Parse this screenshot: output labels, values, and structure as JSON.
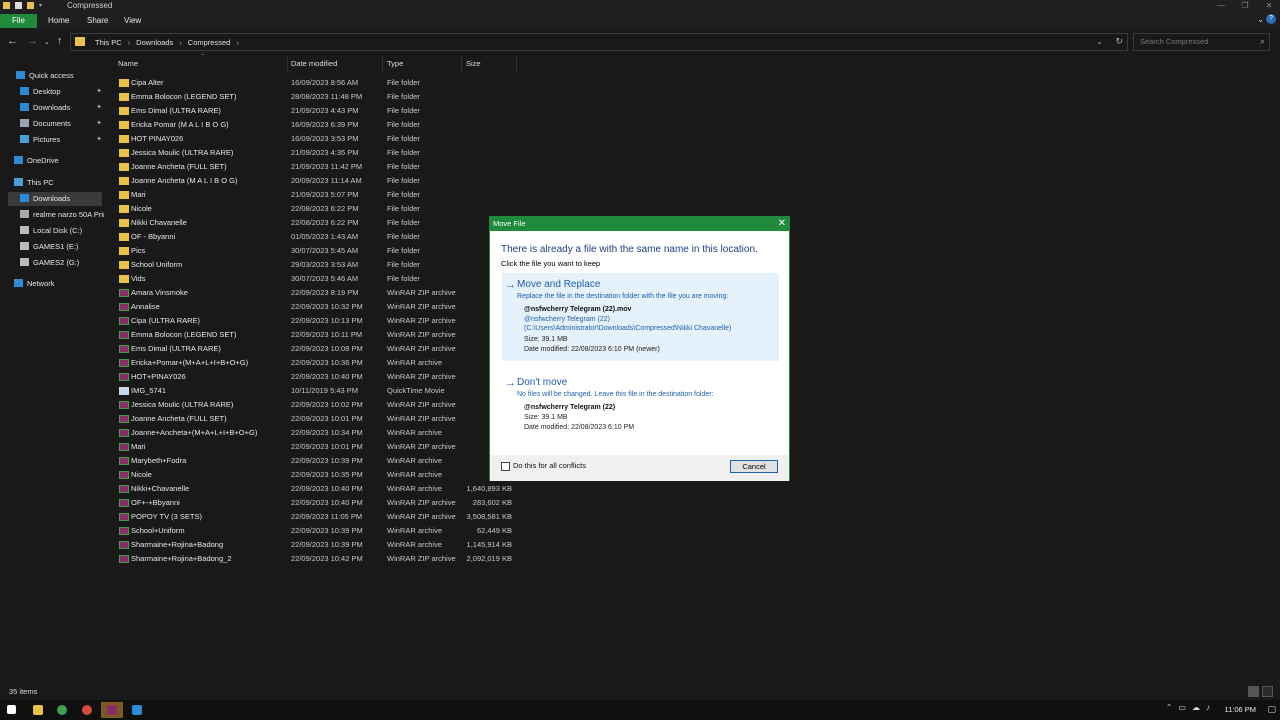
{
  "window": {
    "title": "Compressed",
    "controls": [
      "—",
      "❐",
      "✕"
    ]
  },
  "ribbon": {
    "tabs": [
      "File",
      "Home",
      "Share",
      "View"
    ]
  },
  "address": {
    "crumbs": [
      "This PC",
      "Downloads",
      "Compressed"
    ],
    "search_placeholder": "Search Compressed"
  },
  "nav": {
    "items": [
      {
        "label": "Quick access",
        "icon": "star-icon"
      },
      {
        "label": "Desktop",
        "icon": "desktop-icon",
        "pinned": true
      },
      {
        "label": "Downloads",
        "icon": "download-icon",
        "pinned": true
      },
      {
        "label": "Documents",
        "icon": "document-icon",
        "pinned": true
      },
      {
        "label": "Pictures",
        "icon": "picture-icon",
        "pinned": true
      },
      {
        "label": "OneDrive",
        "icon": "cloud-icon"
      },
      {
        "label": "This PC",
        "icon": "pc-icon"
      },
      {
        "label": "Downloads",
        "icon": "download-icon"
      },
      {
        "label": "realme narzo 50A Prime",
        "icon": "phone-icon"
      },
      {
        "label": "Local Disk (C:)",
        "icon": "drive-icon"
      },
      {
        "label": "GAMES1 (E:)",
        "icon": "drive-icon"
      },
      {
        "label": "GAMES2 (G:)",
        "icon": "drive-icon"
      },
      {
        "label": "Network",
        "icon": "network-icon"
      }
    ]
  },
  "columns": [
    "Name",
    "Date modified",
    "Type",
    "Size"
  ],
  "files": [
    {
      "name": "Cipa Alter",
      "date": "16/09/2023 8:56 AM",
      "type": "File folder",
      "size": "",
      "kind": "folder"
    },
    {
      "name": "Emma Bolocon (LEGEND SET)",
      "date": "28/08/2023 11:48 PM",
      "type": "File folder",
      "size": "",
      "kind": "folder"
    },
    {
      "name": "Ems Dimal (ULTRA RARE)",
      "date": "21/09/2023 4:43 PM",
      "type": "File folder",
      "size": "",
      "kind": "folder"
    },
    {
      "name": "Ericka Pomar (M A L I B O G)",
      "date": "16/09/2023 6:39 PM",
      "type": "File folder",
      "size": "",
      "kind": "folder"
    },
    {
      "name": "HOT PINAY026",
      "date": "16/09/2023 3:53 PM",
      "type": "File folder",
      "size": "",
      "kind": "folder"
    },
    {
      "name": "Jessica Moulic (ULTRA RARE)",
      "date": "21/09/2023 4:35 PM",
      "type": "File folder",
      "size": "",
      "kind": "folder"
    },
    {
      "name": "Joanne Ancheta (FULL SET)",
      "date": "21/09/2023 11:42 PM",
      "type": "File folder",
      "size": "",
      "kind": "folder"
    },
    {
      "name": "Joanne Ancheta (M A L I B O G)",
      "date": "20/09/2023 11:14 AM",
      "type": "File folder",
      "size": "",
      "kind": "folder"
    },
    {
      "name": "Mari",
      "date": "21/09/2023 5:07 PM",
      "type": "File folder",
      "size": "",
      "kind": "folder"
    },
    {
      "name": "Nicole",
      "date": "22/08/2023 6:22 PM",
      "type": "File folder",
      "size": "",
      "kind": "folder"
    },
    {
      "name": "Nikki Chavanelle",
      "date": "22/08/2023 6:22 PM",
      "type": "File folder",
      "size": "",
      "kind": "folder"
    },
    {
      "name": "OF - Bbyanni",
      "date": "01/05/2023 1:43 AM",
      "type": "File folder",
      "size": "",
      "kind": "folder"
    },
    {
      "name": "Pics",
      "date": "30/07/2023 5:45 AM",
      "type": "File folder",
      "size": "",
      "kind": "folder"
    },
    {
      "name": "School Uniform",
      "date": "29/03/2023 3:53 AM",
      "type": "File folder",
      "size": "",
      "kind": "folder"
    },
    {
      "name": "Vids",
      "date": "30/07/2023 5:46 AM",
      "type": "File folder",
      "size": "",
      "kind": "folder"
    },
    {
      "name": "Amara Vinsmoke",
      "date": "22/09/2023 8:19 PM",
      "type": "WinRAR ZIP archive",
      "size": "894,",
      "kind": "zip"
    },
    {
      "name": "Annalise",
      "date": "22/09/2023 10:32 PM",
      "type": "WinRAR ZIP archive",
      "size": "161,",
      "kind": "zip"
    },
    {
      "name": "Cipa (ULTRA RARE)",
      "date": "22/09/2023 10:13 PM",
      "type": "WinRAR ZIP archive",
      "size": "2,411,",
      "kind": "zip"
    },
    {
      "name": "Emma Bolocon (LEGEND SET)",
      "date": "22/09/2023 10:11 PM",
      "type": "WinRAR ZIP archive",
      "size": "187,",
      "kind": "zip"
    },
    {
      "name": "Ems Dimal (ULTRA RARE)",
      "date": "22/09/2023 10:08 PM",
      "type": "WinRAR ZIP archive",
      "size": "962,",
      "kind": "zip"
    },
    {
      "name": "Ericka+Pomar+(M+A+L+I+B+O+G)",
      "date": "22/09/2023 10:36 PM",
      "type": "WinRAR archive",
      "size": "116,",
      "kind": "zip"
    },
    {
      "name": "HOT+PINAY026",
      "date": "22/09/2023 10:40 PM",
      "type": "WinRAR ZIP archive",
      "size": "70,",
      "kind": "zip"
    },
    {
      "name": "IMG_5741",
      "date": "10/11/2019 5:43 PM",
      "type": "QuickTime Movie",
      "size": "350,",
      "kind": "mov"
    },
    {
      "name": "Jessica Moulic (ULTRA RARE)",
      "date": "22/09/2023 10:02 PM",
      "type": "WinRAR ZIP archive",
      "size": "446,",
      "kind": "zip"
    },
    {
      "name": "Joanne Ancheta (FULL SET)",
      "date": "22/09/2023 10:01 PM",
      "type": "WinRAR ZIP archive",
      "size": "460,",
      "kind": "zip"
    },
    {
      "name": "Joanne+Ancheta+(M+A+L+I+B+O+G)",
      "date": "22/09/2023 10:34 PM",
      "type": "WinRAR archive",
      "size": "259,",
      "kind": "zip"
    },
    {
      "name": "Mari",
      "date": "22/09/2023 10:01 PM",
      "type": "WinRAR ZIP archive",
      "size": "135,",
      "kind": "zip"
    },
    {
      "name": "Marybeth+Fodra",
      "date": "22/09/2023 10:39 PM",
      "type": "WinRAR archive",
      "size": "47,",
      "kind": "zip"
    },
    {
      "name": "Nicole",
      "date": "22/09/2023 10:35 PM",
      "type": "WinRAR archive",
      "size": "393,",
      "kind": "zip"
    },
    {
      "name": "Nikki+Chavanelle",
      "date": "22/09/2023 10:40 PM",
      "type": "WinRAR archive",
      "size": "1,640,893 KB",
      "kind": "zip"
    },
    {
      "name": "OF+-+Bbyanni",
      "date": "22/09/2023 10:40 PM",
      "type": "WinRAR ZIP archive",
      "size": "283,602 KB",
      "kind": "zip"
    },
    {
      "name": "POPOY TV (3 SETS)",
      "date": "22/09/2023 11:05 PM",
      "type": "WinRAR ZIP archive",
      "size": "3,508,581 KB",
      "kind": "zip"
    },
    {
      "name": "School+Uniform",
      "date": "22/09/2023 10:39 PM",
      "type": "WinRAR archive",
      "size": "62,449 KB",
      "kind": "zip"
    },
    {
      "name": "Sharmaine+Rojina+Badong",
      "date": "22/09/2023 10:39 PM",
      "type": "WinRAR archive",
      "size": "1,145,914 KB",
      "kind": "zip"
    },
    {
      "name": "Sharmaine+Rojina+Badong_2",
      "date": "22/09/2023 10:42 PM",
      "type": "WinRAR ZIP archive",
      "size": "2,092,019 KB",
      "kind": "zip"
    }
  ],
  "dialog": {
    "title": "Move File",
    "heading": "There is already a file with the same name in this location.",
    "subheading": "Click the file you want to keep",
    "replace": {
      "title": "Move and Replace",
      "desc": "Replace the file in the destination folder with the file you are moving:",
      "filename": "@nsfwcherry Telegram (22).mov",
      "source_name": "@nsfwcherry Telegram (22)",
      "source_path": "(C:\\Users\\Administrator\\Downloads\\Compressed\\Nikki Chavanelle)",
      "size": "Size: 39.1 MB",
      "date": "Date modified: 22/08/2023 6:10 PM (newer)"
    },
    "skip": {
      "title": "Don't move",
      "desc": "No files will be changed. Leave this file in the destination folder:",
      "filename": "@nsfwcherry Telegram (22)",
      "size": "Size: 39.1 MB",
      "date": "Date modified: 22/08/2023 6:10 PM"
    },
    "checkbox_label": "Do this for all conflicts",
    "cancel_label": "Cancel"
  },
  "status": {
    "item_count": "35 items"
  },
  "taskbar": {
    "time": "11:06 PM"
  }
}
